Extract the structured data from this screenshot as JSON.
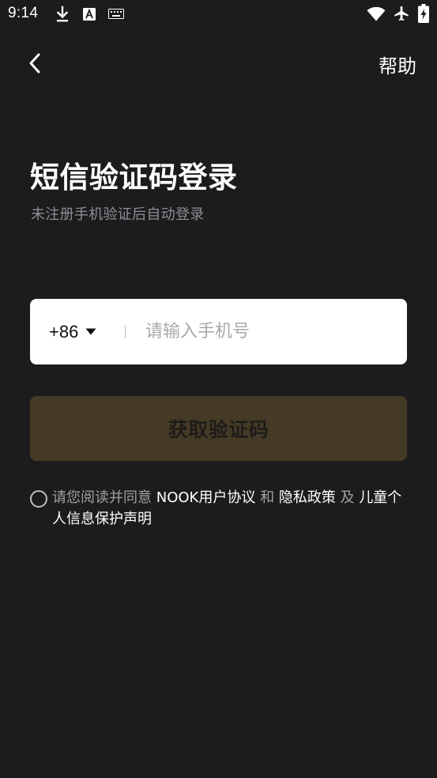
{
  "status_bar": {
    "time": "9:14",
    "icons": [
      "download-icon",
      "font-a-icon",
      "keyboard-icon",
      "wifi-icon",
      "airplane-mode-icon",
      "battery-charging-icon"
    ]
  },
  "nav": {
    "back_icon": "chevron-left-icon",
    "help_label": "帮助"
  },
  "login": {
    "title": "短信验证码登录",
    "subtitle": "未注册手机验证后自动登录"
  },
  "phone": {
    "country_code": "+86",
    "country_caret_icon": "caret-down-icon",
    "value": "",
    "placeholder": "请输入手机号"
  },
  "get_code_button": {
    "label": "获取验证码",
    "state": "disabled"
  },
  "agreement": {
    "checked": false,
    "prefix": "请您阅读并同意 ",
    "user_agreement": "NOOK用户协议",
    "and": " 和 ",
    "privacy_policy": "隐私政策",
    "and2": " 及 ",
    "children_privacy": "儿童个人信息保护声明"
  },
  "colors": {
    "background": "#1c1c1e",
    "input_background": "#ffffff",
    "button_background_disabled": "#453a25",
    "subtitle_text": "#8e8e93",
    "link_text": "#ffffff"
  }
}
